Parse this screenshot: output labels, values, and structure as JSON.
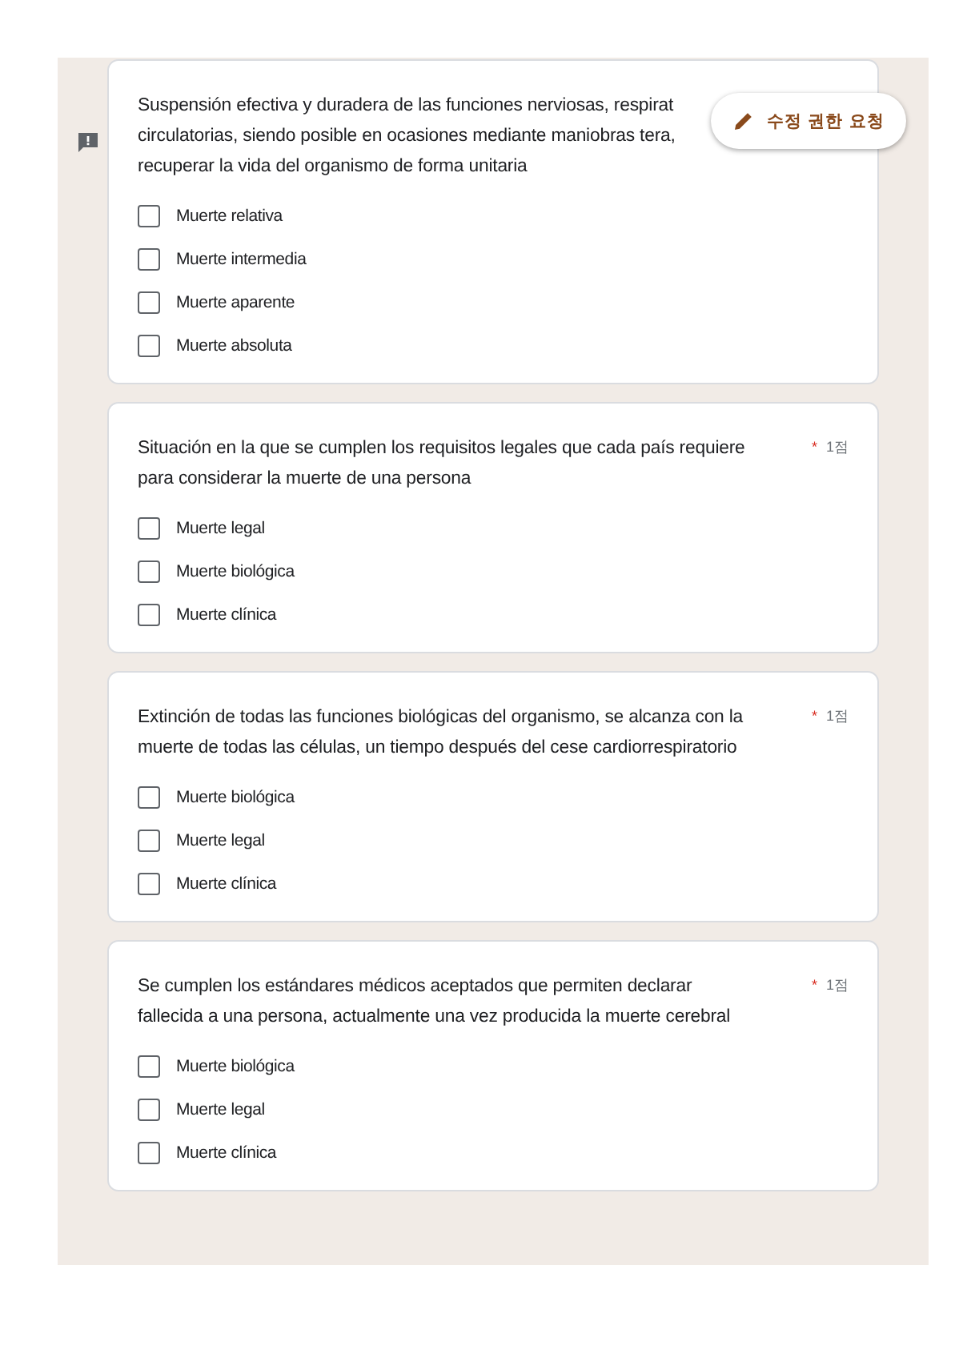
{
  "request_edit_button": {
    "label": "수정 권한 요청"
  },
  "questions": [
    {
      "title_lines": [
        "Suspensión efectiva y duradera de las funciones nerviosas, respirat",
        "circulatorias, siendo posible en ocasiones mediante maniobras tera,",
        "recuperar la vida del organismo de forma unitaria"
      ],
      "feedback": true,
      "options": [
        {
          "label": "Muerte relativa",
          "checked": false
        },
        {
          "label": "Muerte intermedia",
          "checked": false
        },
        {
          "label": "Muerte aparente",
          "checked": false
        },
        {
          "label": "Muerte absoluta",
          "checked": false
        }
      ]
    },
    {
      "title_lines": [
        "Situación en la que se cumplen los requisitos legales que cada país requiere",
        "para considerar la muerte de una persona"
      ],
      "required_mark": "*",
      "points": "1점",
      "feedback": false,
      "options": [
        {
          "label": "Muerte legal",
          "checked": false
        },
        {
          "label": "Muerte biológica",
          "checked": false
        },
        {
          "label": "Muerte clínica",
          "checked": false
        }
      ]
    },
    {
      "title_lines": [
        "Extinción de todas las funciones biológicas del organismo, se alcanza con la",
        "muerte de todas las células, un tiempo después del cese cardiorrespiratorio"
      ],
      "required_mark": "*",
      "points": "1점",
      "feedback": false,
      "options": [
        {
          "label": "Muerte biológica",
          "checked": false
        },
        {
          "label": "Muerte legal",
          "checked": false
        },
        {
          "label": "Muerte clínica",
          "checked": false
        }
      ]
    },
    {
      "title_lines": [
        "Se cumplen los estándares médicos aceptados que permiten declarar",
        "fallecida a una persona, actualmente una vez producida la muerte cerebral"
      ],
      "required_mark": "*",
      "points": "1점",
      "feedback": false,
      "options": [
        {
          "label": "Muerte biológica",
          "checked": false
        },
        {
          "label": "Muerte legal",
          "checked": false
        },
        {
          "label": "Muerte clínica",
          "checked": false
        }
      ]
    }
  ]
}
